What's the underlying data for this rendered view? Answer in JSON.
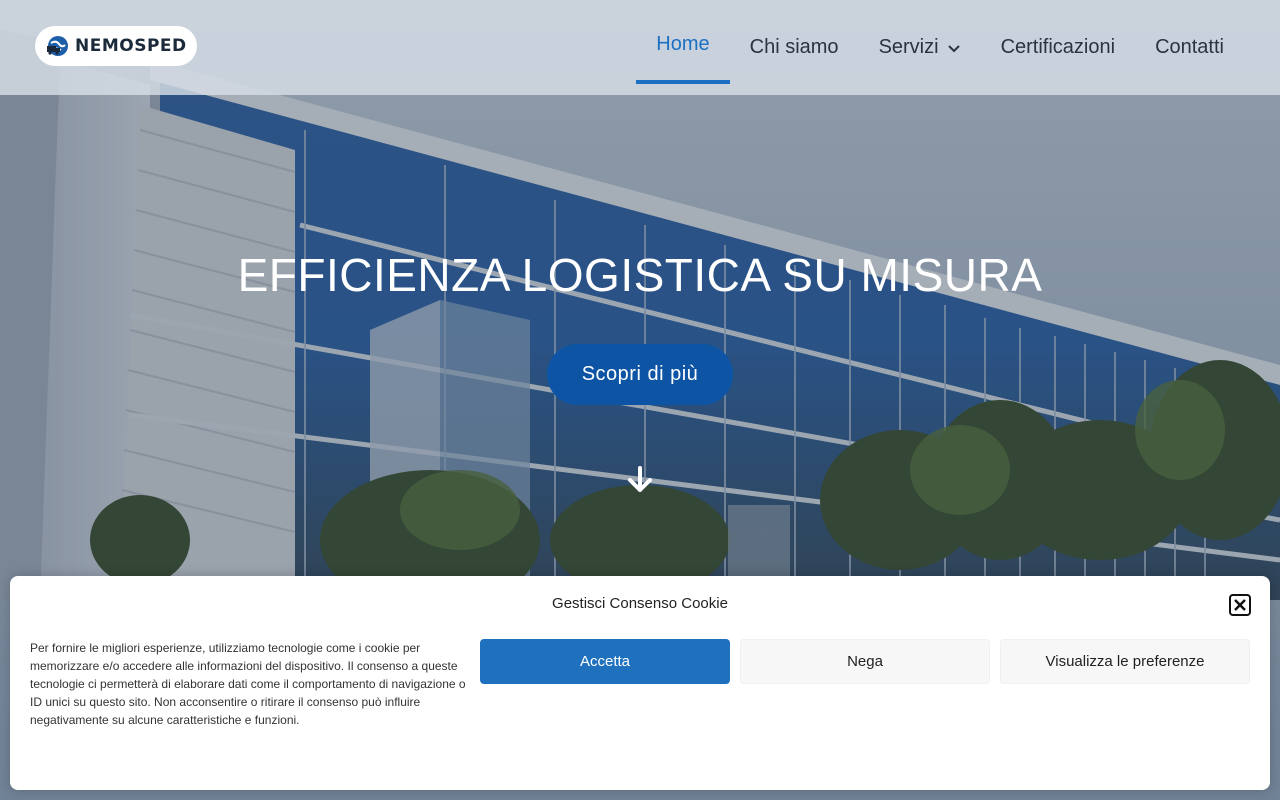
{
  "brand": {
    "name": "NEMOSPED",
    "logo_icon": "globe-truck-icon"
  },
  "nav": {
    "items": [
      {
        "label": "Home",
        "active": true
      },
      {
        "label": "Chi siamo",
        "active": false
      },
      {
        "label": "Servizi",
        "active": false,
        "has_dropdown": true
      },
      {
        "label": "Certificazioni",
        "active": false
      },
      {
        "label": "Contatti",
        "active": false
      }
    ]
  },
  "hero": {
    "title": "EFFICIENZA LOGISTICA SU MISURA",
    "cta_label": "Scopri di più",
    "scroll_icon": "arrow-down-icon"
  },
  "cookie_banner": {
    "title": "Gestisci Consenso Cookie",
    "text": "Per fornire le migliori esperienze, utilizziamo tecnologie come i cookie per memorizzare e/o accedere alle informazioni del dispositivo. Il consenso a queste tecnologie ci permetterà di elaborare dati come il comportamento di navigazione o ID unici su questo sito. Non acconsentire o ritirare il consenso può influire negativamente su alcune caratteristiche e funzioni.",
    "accept_label": "Accetta",
    "deny_label": "Nega",
    "prefs_label": "Visualizza le preferenze",
    "close_icon": "close-icon"
  },
  "colors": {
    "accent": "#1c6fc2",
    "cta_bg": "#0d55a4",
    "accept_bg": "#1f71be"
  }
}
